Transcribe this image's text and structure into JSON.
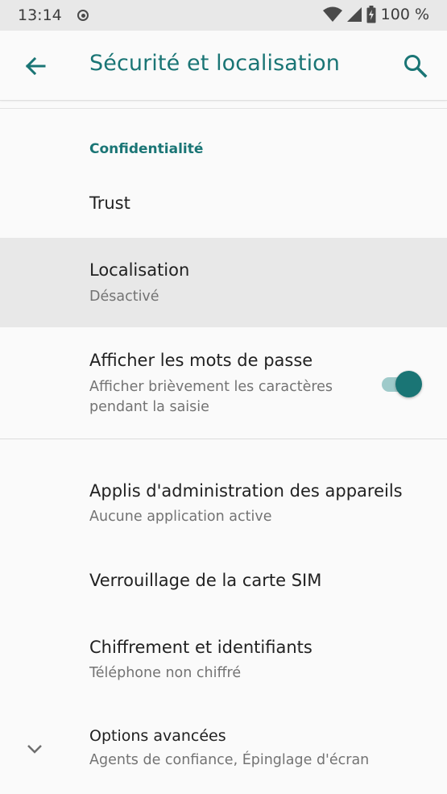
{
  "status_bar": {
    "time": "13:14",
    "battery": "100 %"
  },
  "app_bar": {
    "title": "Sécurité et localisation",
    "back_icon": "arrow-back-icon",
    "search_icon": "search-icon"
  },
  "section": {
    "header": "Confidentialité"
  },
  "items": {
    "trust": {
      "title": "Trust"
    },
    "location": {
      "title": "Localisation",
      "subtitle": "Désactivé"
    },
    "passwords": {
      "title": "Afficher les mots de passe",
      "subtitle": "Afficher brièvement les caractères pendant la saisie",
      "toggle_on": true
    },
    "admin": {
      "title": "Applis d'administration des appareils",
      "subtitle": "Aucune application active"
    },
    "sim": {
      "title": "Verrouillage de la carte SIM"
    },
    "crypto": {
      "title": "Chiffrement et identifiants",
      "subtitle": "Téléphone non chiffré"
    },
    "advanced": {
      "title": "Options avancées",
      "subtitle": "Agents de confiance, Épinglage d'écran"
    }
  },
  "colors": {
    "accent": "#1a7575",
    "toggle_track": "#9fcaca",
    "highlight_row": "#e8e8e8",
    "background": "#fafafa"
  }
}
